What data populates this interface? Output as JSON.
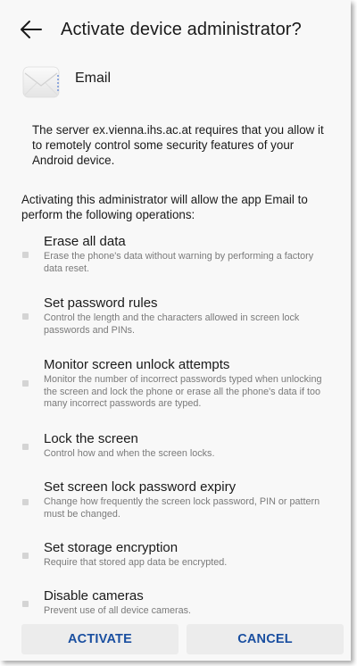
{
  "header": {
    "back_icon": "arrow-left-icon",
    "title": "Activate device administrator?"
  },
  "app": {
    "icon": "email-envelope-icon",
    "name": "Email"
  },
  "warning_text": "The server ex.vienna.ihs.ac.at requires that you allow it to remotely control some security features of your Android device.",
  "intro_text": "Activating this administrator will allow the app Email to perform the following operations:",
  "permissions": [
    {
      "title": "Erase all data",
      "description": "Erase the phone's data without warning by performing a factory data reset."
    },
    {
      "title": "Set password rules",
      "description": "Control the length and the characters allowed in screen lock passwords and PINs."
    },
    {
      "title": "Monitor screen unlock attempts",
      "description": "Monitor the number of incorrect passwords typed when unlocking the screen and lock the phone or erase all the phone's data if too many incorrect passwords are typed."
    },
    {
      "title": "Lock the screen",
      "description": "Control how and when the screen locks."
    },
    {
      "title": "Set screen lock password expiry",
      "description": "Change how frequently the screen lock password, PIN or pattern must be changed."
    },
    {
      "title": "Set storage encryption",
      "description": "Require that stored app data be encrypted."
    },
    {
      "title": "Disable cameras",
      "description": "Prevent use of all device cameras."
    }
  ],
  "buttons": {
    "activate_label": "ACTIVATE",
    "cancel_label": "CANCEL"
  },
  "colors": {
    "button_text": "#1a4fa0",
    "background": "#f8f8f8",
    "button_bg": "#ececec",
    "description_text": "#7a7a7a"
  }
}
